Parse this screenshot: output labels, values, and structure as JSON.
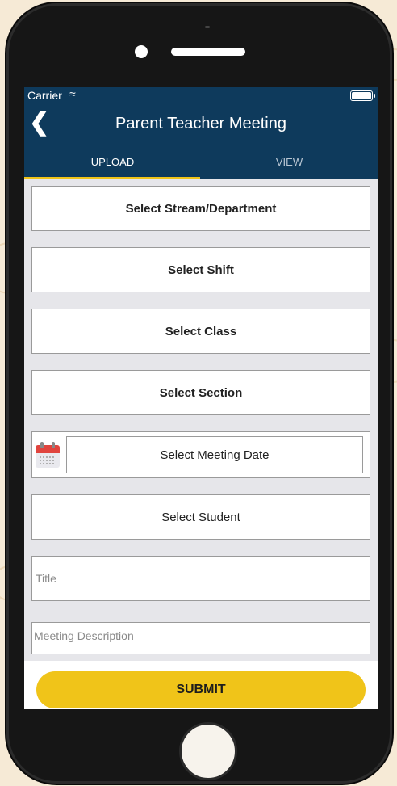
{
  "status_bar": {
    "carrier": "Carrier",
    "wifi_icon": "wifi-icon",
    "battery_icon": "battery-icon"
  },
  "header": {
    "back_icon": "chevron-left-icon",
    "title": "Parent Teacher Meeting"
  },
  "tabs": [
    {
      "label": "UPLOAD",
      "active": true
    },
    {
      "label": "VIEW",
      "active": false
    }
  ],
  "form": {
    "stream": "Select Stream/Department",
    "shift": "Select Shift",
    "class": "Select Class",
    "section": "Select Section",
    "meeting_date": "Select Meeting Date",
    "student": "Select Student",
    "title_placeholder": "Title",
    "description_placeholder": "Meeting Description"
  },
  "submit_label": "SUBMIT",
  "colors": {
    "header": "#0e3a5c",
    "accent": "#f0c419",
    "background": "#e6e6ea"
  }
}
